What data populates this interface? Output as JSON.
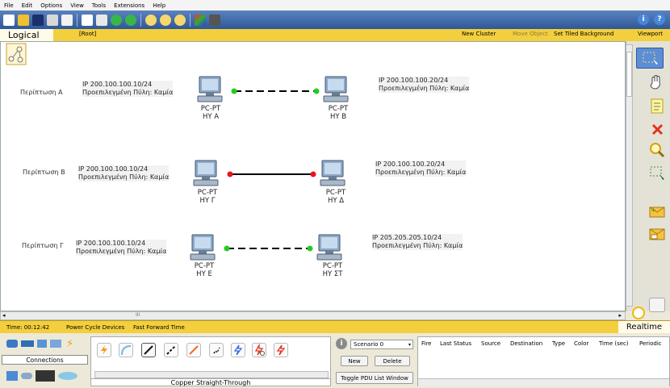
{
  "menu": {
    "items": [
      "File",
      "Edit",
      "Options",
      "View",
      "Tools",
      "Extensions",
      "Help"
    ]
  },
  "logical_bar": {
    "tab": "Logical",
    "root": "[Root]",
    "new_cluster": "New Cluster",
    "move_object": "Move Object",
    "set_tiled_background": "Set Tiled Background",
    "viewport": "Viewport"
  },
  "cases": [
    {
      "label": "Περίπτωση Α",
      "left_ip": "IP 200.100.100.10/24",
      "left_gw": "Προεπιλεγμένη Πύλη: Καμία",
      "right_ip": "IP 200.100.100.20/24",
      "right_gw": "Προεπιλεγμένη Πύλη: Καμία",
      "pc_left_type": "PC-PT",
      "pc_left_name": "ΗΥ Α",
      "pc_right_type": "PC-PT",
      "pc_right_name": "ΗΥ Β",
      "link": "dashed",
      "link_color": "#22cc22"
    },
    {
      "label": "Περίπτωση Β",
      "left_ip": "IP 200.100.100.10/24",
      "left_gw": "Προεπιλεγμένη Πύλη: Καμία",
      "right_ip": "IP 200.100.100.20/24",
      "right_gw": "Προεπιλεγμένη Πύλη: Καμία",
      "pc_left_type": "PC-PT",
      "pc_left_name": "ΗΥ Γ",
      "pc_right_type": "PC-PT",
      "pc_right_name": "ΗΥ Δ",
      "link": "solid",
      "link_color": "#e8141e"
    },
    {
      "label": "Περίπτωση Γ",
      "left_ip": "IP 200.100.100.10/24",
      "left_gw": "Προεπιλεγμένη Πύλη: Καμία",
      "right_ip": "IP 205.205.205.10/24",
      "right_gw": "Προεπιλεγμένη Πύλη: Καμία",
      "pc_left_type": "PC-PT",
      "pc_left_name": "ΗΥ Ε",
      "pc_right_type": "PC-PT",
      "pc_right_name": "ΗΥ ΣΤ",
      "link": "dashed",
      "link_color": "#22cc22"
    }
  ],
  "time_bar": {
    "time": "Time: 00:12:42",
    "power_cycle": "Power Cycle Devices",
    "fast_forward": "Fast Forward Time",
    "realtime": "Realtime"
  },
  "bottom": {
    "category_label": "Connections",
    "connection_label": "Copper Straight-Through",
    "scenario": "Scenario 0",
    "new_label": "New",
    "delete_label": "Delete",
    "toggle_label": "Toggle PDU List Window",
    "pdu_columns": [
      "Fire",
      "Last Status",
      "Source",
      "Destination",
      "Type",
      "Color",
      "Time (sec)",
      "Periodic"
    ]
  },
  "scroll": {
    "h_thumb": "III"
  },
  "colors": {
    "accent_yellow": "#f3cf3d",
    "toolbar_blue": "#2e5898",
    "link_up": "#22cc22",
    "link_down": "#e8141e"
  }
}
